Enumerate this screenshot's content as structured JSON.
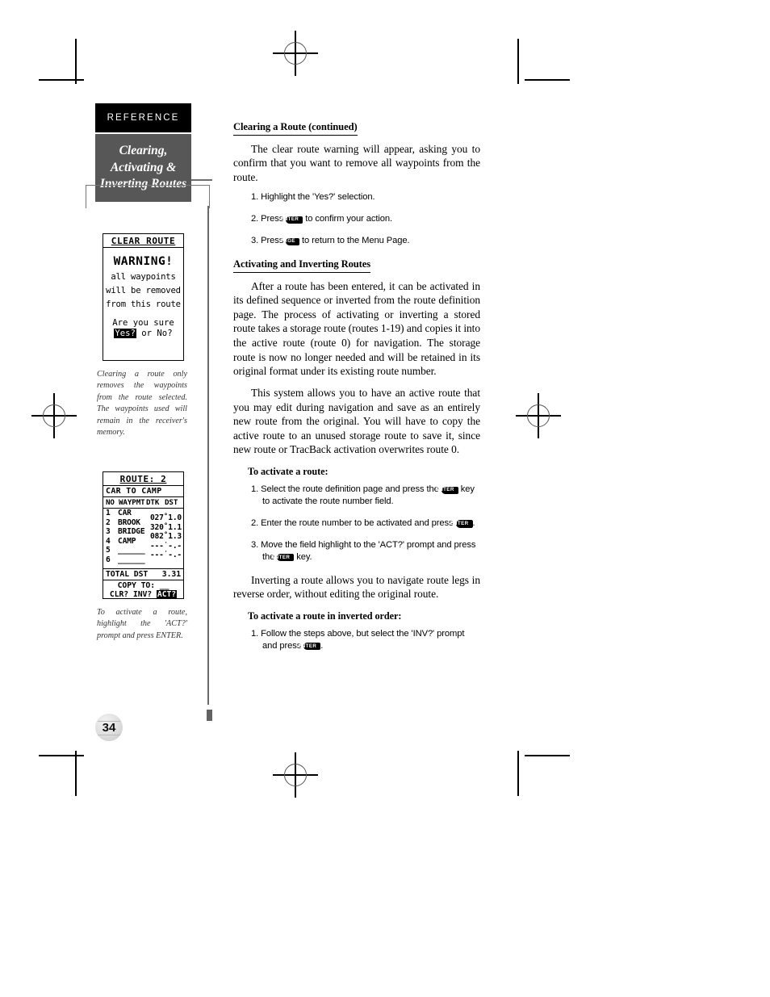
{
  "sidebar": {
    "section_label": "REFERENCE",
    "chapter_lines": [
      "Clearing,",
      "Activating &",
      "Inverting Routes"
    ]
  },
  "figures": [
    {
      "name": "clear-route-warning",
      "title": "CLEAR ROUTE",
      "warning_word": "WARNING!",
      "lines": [
        "all waypoints",
        "will be removed",
        "from this route"
      ],
      "question": "Are you sure",
      "answer_highlighted": "Yes?",
      "answer_rest": " or No?",
      "caption": "Clearing a route only removes the waypoints from the route selected. The waypoints used will remain in the receiver's memory."
    },
    {
      "name": "route-definition-page",
      "title": "ROUTE: 2",
      "route_name": "CAR TO CAMP",
      "columns": [
        "NO",
        "WAYPMT",
        "DTK",
        "DST"
      ],
      "rows": [
        {
          "no": "1",
          "waypoint": "CAR"
        },
        {
          "no": "2",
          "waypoint": "BROOK"
        },
        {
          "no": "3",
          "waypoint": "BRIDGE"
        },
        {
          "no": "4",
          "waypoint": "CAMP"
        },
        {
          "no": "5",
          "waypoint": "______"
        },
        {
          "no": "6",
          "waypoint": "______"
        }
      ],
      "legs": [
        "027˚1.0",
        "320˚1.1",
        "082˚1.3",
        "---˙-.-",
        "---˙-.-"
      ],
      "total_label": "TOTAL DST",
      "total_value": "3.31",
      "copy_to": "COPY TO: __",
      "prompts_prefix": "CLR? INV? ",
      "prompt_highlighted": "ACT?",
      "caption": "To activate a route, highlight the 'ACT?' prompt and press ENTER."
    }
  ],
  "main": {
    "heading1": "Clearing a Route (continued)",
    "para1": "The clear route warning will appear, asking you to confirm that you want to remove all waypoints from the route.",
    "steps1": [
      {
        "num": "1.",
        "before": "Highlight the 'Yes?' selection.",
        "key": "",
        "after": ""
      },
      {
        "num": "2.",
        "before": "Press ",
        "key": "ENTER",
        "after": " to confirm your action."
      },
      {
        "num": "3.",
        "before": "Press ",
        "key": "PAGE",
        "after": " to return to the Menu Page."
      }
    ],
    "heading2": "Activating and Inverting Routes",
    "para2": "After a route has been entered, it can be activated in its defined sequence or inverted from the route definition page. The process of activating or inverting a stored route takes a storage route (routes 1-19) and copies it into the active route (route 0) for navigation. The storage route is now no longer needed and will be retained in its original format under its existing route number.",
    "para3": "This system allows you to have an active route that you may edit during navigation and save as an entirely new route from the original. You will have to copy the active route to an unused storage route to save it, since new route or TracBack activation overwrites route 0.",
    "subheading1": "To activate a route:",
    "steps2": [
      {
        "num": "1.",
        "before": "Select the route definition page and press the ",
        "key": "ENTER",
        "after": " key to activate the route number field."
      },
      {
        "num": "2.",
        "before": "Enter the route number to be activated and press ",
        "key": "ENTER",
        "after": "."
      },
      {
        "num": "3.",
        "before": "Move the field highlight to the 'ACT?' prompt and press the ",
        "key": "ENTER",
        "after": " key."
      }
    ],
    "para4": "Inverting a route allows you to navigate route legs in reverse order, without editing the original route.",
    "subheading2": "To activate a route in inverted order:",
    "steps3": [
      {
        "num": "1.",
        "before": "Follow the steps above, but select the 'INV?' prompt and press ",
        "key": "ENTER",
        "after": "."
      }
    ]
  },
  "page_number": "34"
}
